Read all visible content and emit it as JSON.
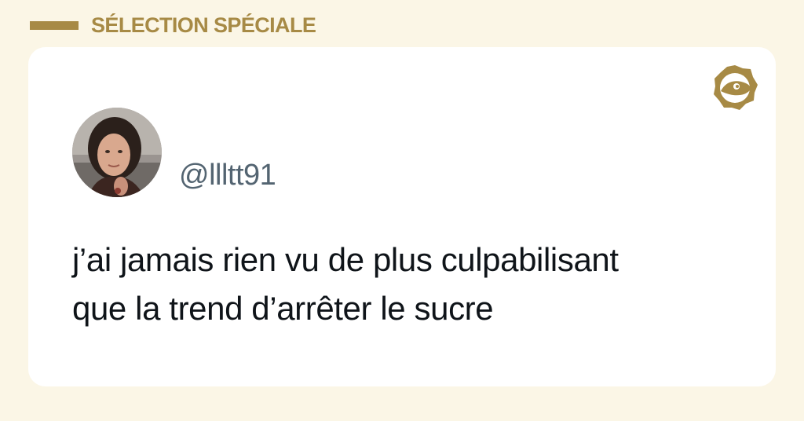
{
  "header": {
    "title": "SÉLECTION SPÉCIALE",
    "accent_color": "#a78a45"
  },
  "card": {
    "brand_icon": "fish-eye-badge-icon",
    "author": {
      "avatar": "profile-photo-avatar",
      "handle": "@llltt91"
    },
    "tweet_lines": [
      "j’ai jamais rien vu de plus culpabilisant",
      "que la trend d’arrêter le sucre"
    ]
  }
}
